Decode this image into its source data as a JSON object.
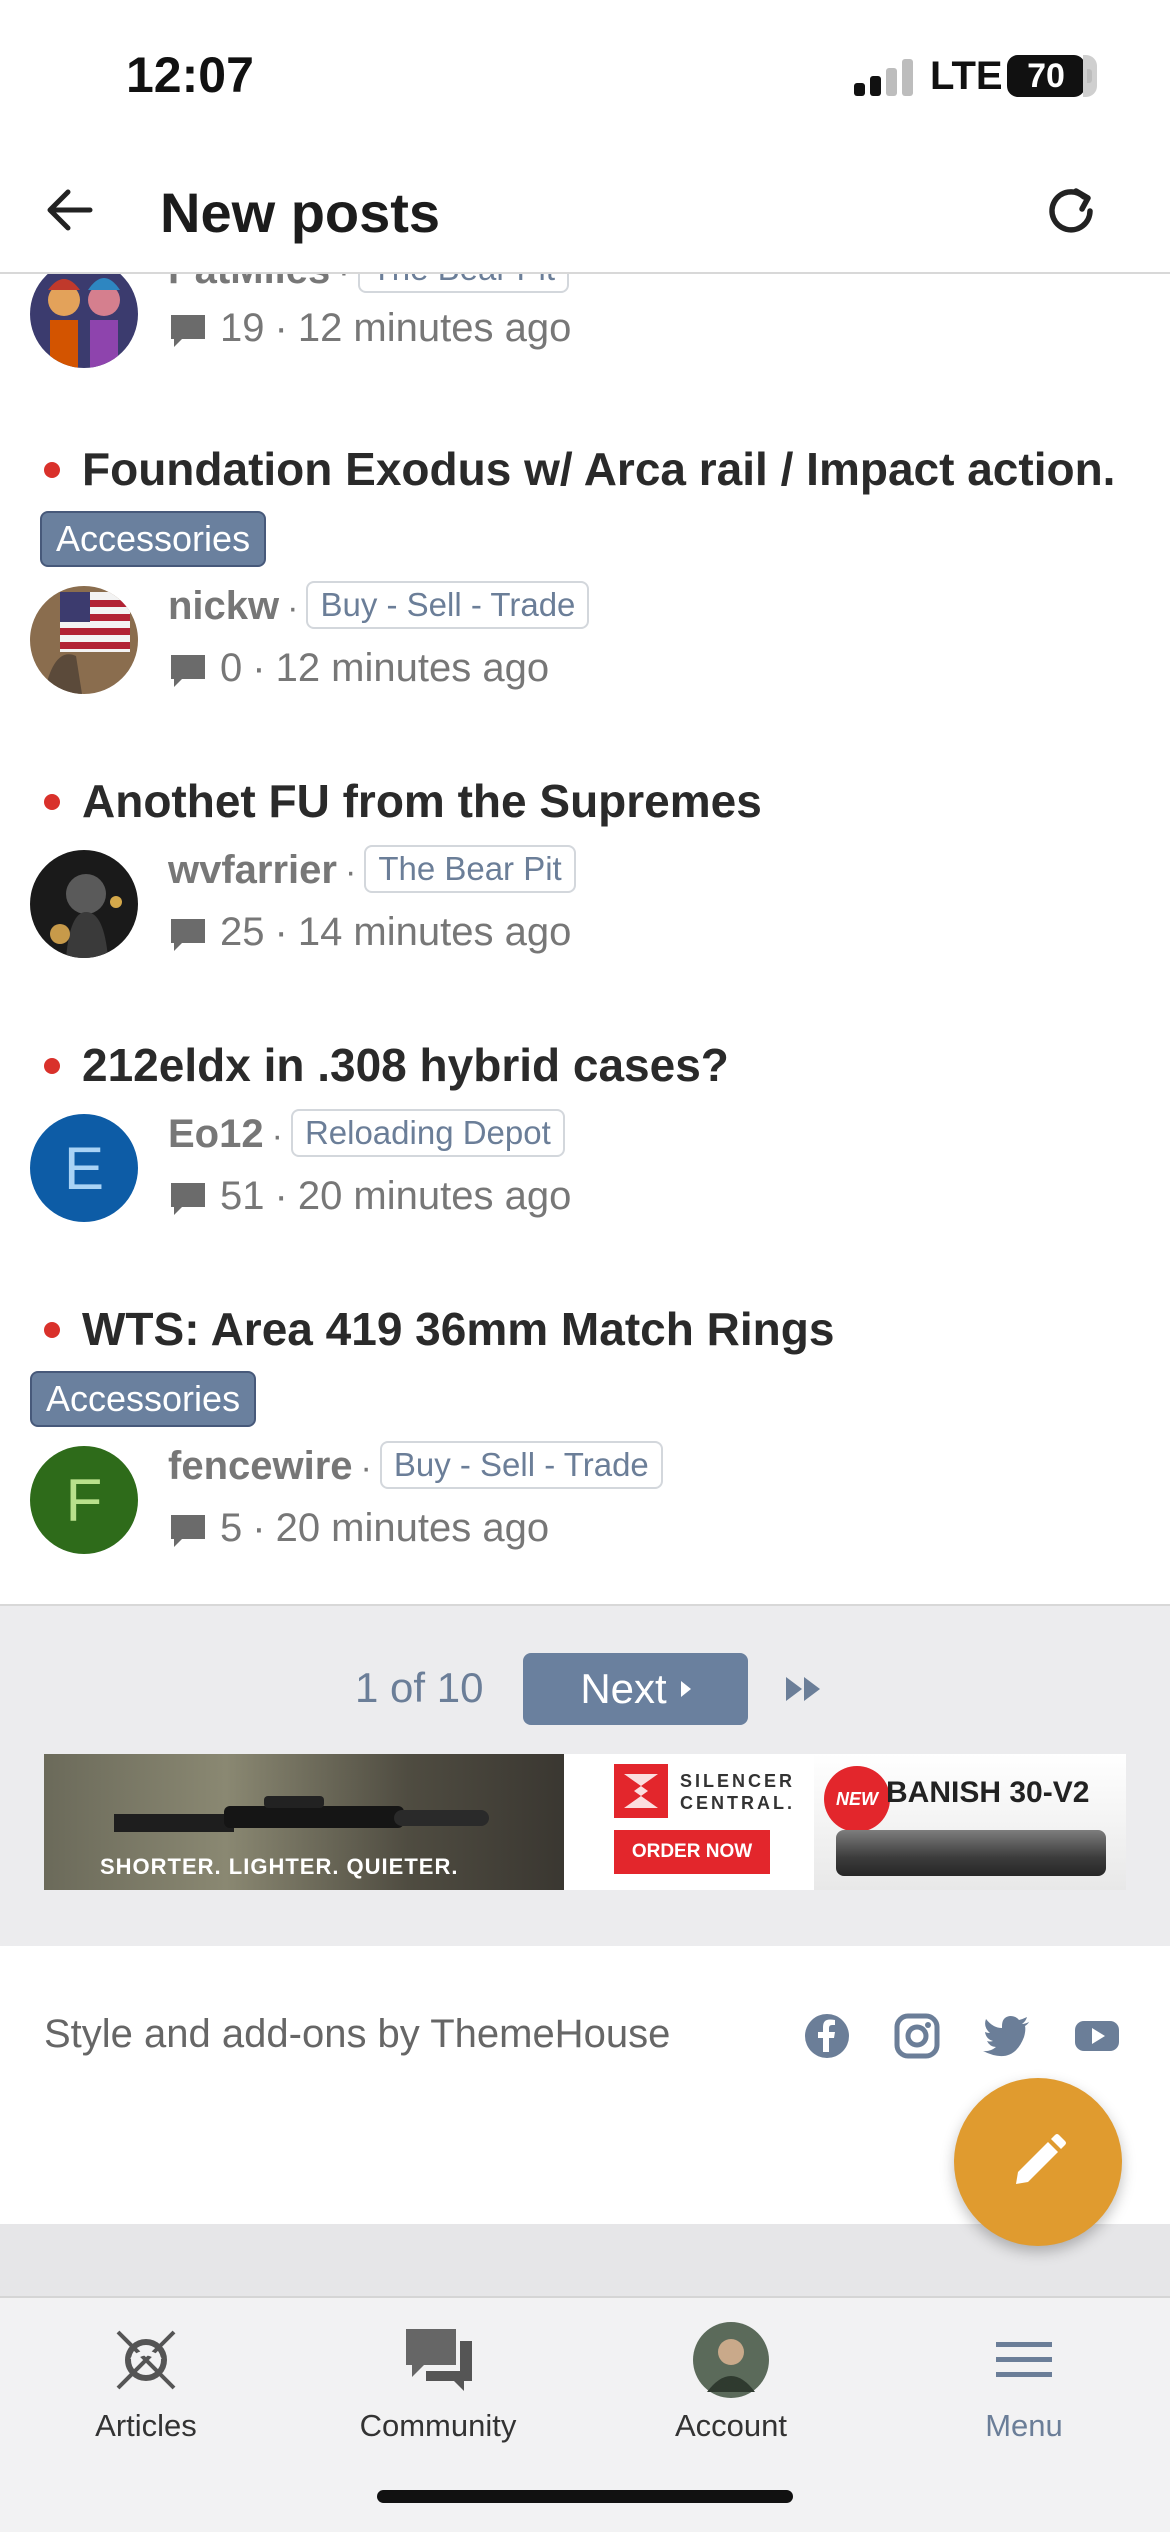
{
  "status_bar": {
    "time": "12:07",
    "network": "LTE",
    "battery": "70"
  },
  "header": {
    "title": "New posts"
  },
  "threads": [
    {
      "title": "",
      "prefix": "",
      "author": "PatMiles",
      "forum": "The Bear Pit",
      "replies": "19",
      "time": "12 minutes ago",
      "avatar": "clowns"
    },
    {
      "title": "Foundation Exodus w/ Arca rail / Impact action.",
      "prefix": "Accessories",
      "author": "nickw",
      "forum": "Buy - Sell - Trade",
      "replies": "0",
      "time": "12 minutes ago",
      "avatar": "flag"
    },
    {
      "title": "Anothet FU from the Supremes",
      "prefix": "",
      "author": "wvfarrier",
      "forum": "The Bear Pit",
      "replies": "25",
      "time": "14 minutes ago",
      "avatar": "smoke"
    },
    {
      "title": "212eldx in .308 hybrid cases?",
      "prefix": "",
      "author": "Eo12",
      "forum": "Reloading Depot",
      "replies": "51",
      "time": "20 minutes ago",
      "avatar_letter": "E",
      "avatar_color": "#0d5ca6"
    },
    {
      "title": "WTS: Area 419 36mm Match Rings",
      "prefix": "Accessories",
      "author": "fencewire",
      "forum": "Buy - Sell - Trade",
      "replies": "5",
      "time": "20 minutes ago",
      "avatar_letter": "F",
      "avatar_color": "#2e6b1a"
    }
  ],
  "pagination": {
    "label": "1 of 10",
    "next_label": "Next"
  },
  "ad": {
    "slogan": "SHORTER. LIGHTER. QUIETER.",
    "brand_line1": "SILENCER",
    "brand_line2": "CENTRAL.",
    "cta": "ORDER NOW",
    "badge": "NEW",
    "product": "BANISH 30-V2"
  },
  "footer": {
    "credit": "Style and add-ons by ThemeHouse",
    "social": [
      "facebook-icon",
      "instagram-icon",
      "twitter-icon",
      "youtube-icon"
    ]
  },
  "bottom_nav": [
    {
      "label": "Articles",
      "icon": "articles-icon"
    },
    {
      "label": "Community",
      "icon": "chat-icon"
    },
    {
      "label": "Account",
      "icon": "avatar"
    },
    {
      "label": "Menu",
      "icon": "hamburger-icon"
    }
  ],
  "colors": {
    "accent": "#6a809e",
    "unread": "#d9312b",
    "fab": "#e09b2f"
  }
}
